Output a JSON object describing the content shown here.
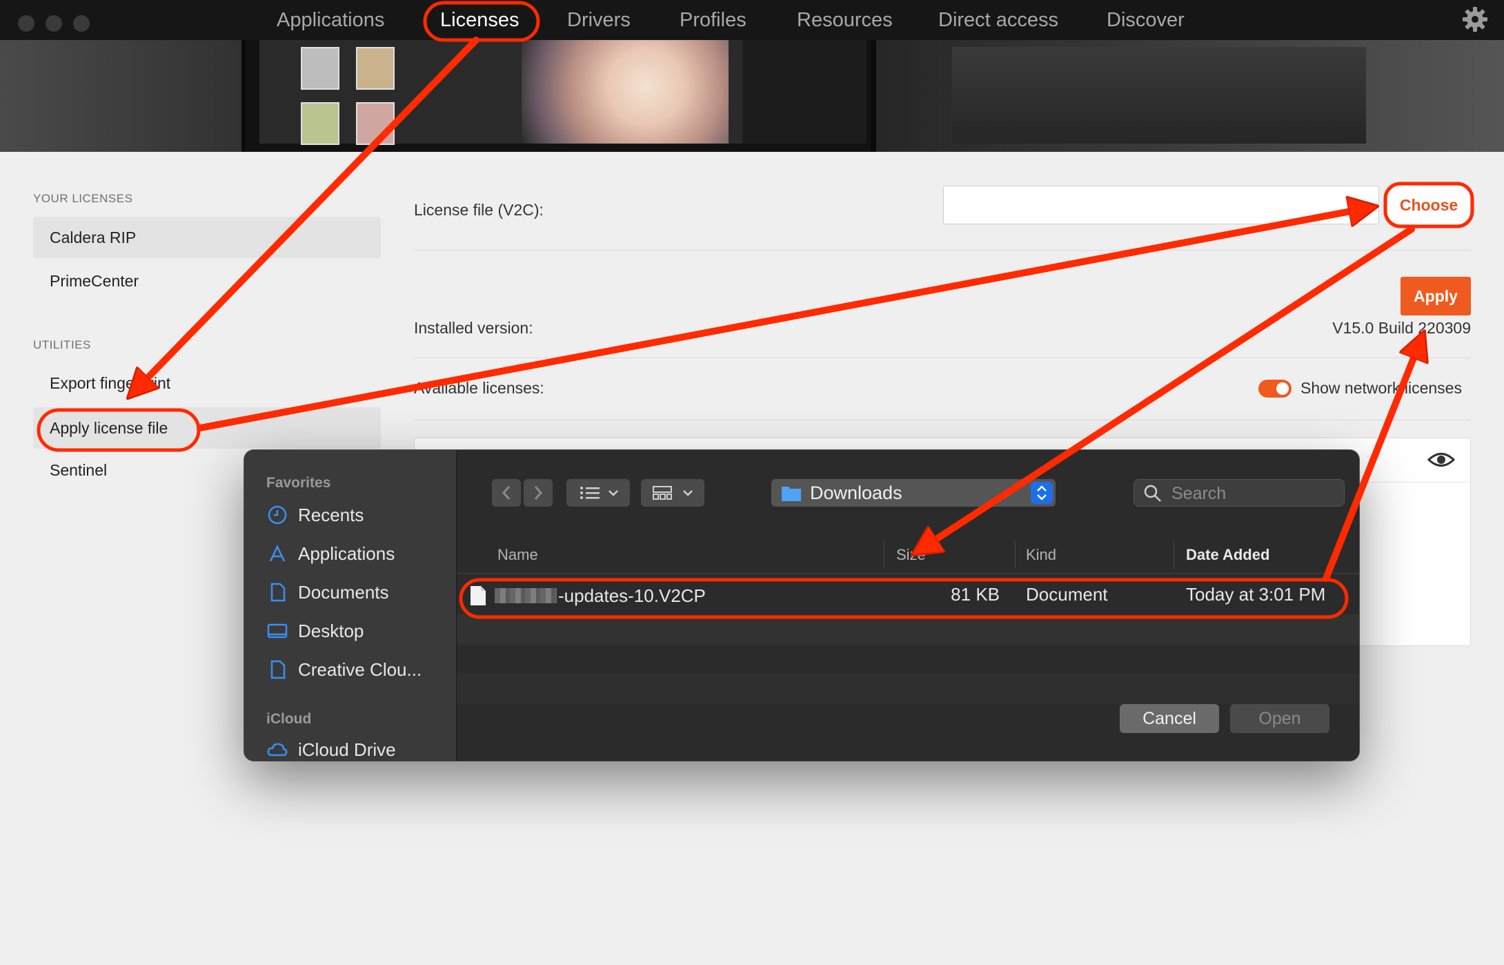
{
  "nav": {
    "tabs": [
      {
        "label": "Applications"
      },
      {
        "label": "Licenses"
      },
      {
        "label": "Drivers"
      },
      {
        "label": "Profiles"
      },
      {
        "label": "Resources"
      },
      {
        "label": "Direct access"
      },
      {
        "label": "Discover"
      }
    ],
    "active": "Licenses"
  },
  "sidebar": {
    "your_licenses_label": "YOUR LICENSES",
    "licenses": [
      {
        "label": "Caldera RIP"
      },
      {
        "label": "PrimeCenter"
      }
    ],
    "utilities_label": "UTILITIES",
    "utilities": [
      {
        "label": "Export fingerprint"
      },
      {
        "label": "Apply license file"
      },
      {
        "label": "Sentinel"
      }
    ]
  },
  "main": {
    "license_file_label": "License file (V2C):",
    "license_file_value": "",
    "choose_label": "Choose",
    "apply_label": "Apply",
    "installed_version_label": "Installed version:",
    "installed_version_value": "V15.0 Build 220309",
    "available_licenses_label": "Available licenses:",
    "show_network_label": "Show network licenses",
    "show_network_on": true
  },
  "dialog": {
    "favorites_label": "Favorites",
    "favorites": [
      {
        "label": "Recents",
        "icon": "clock-icon"
      },
      {
        "label": "Applications",
        "icon": "apps-icon"
      },
      {
        "label": "Documents",
        "icon": "document-icon"
      },
      {
        "label": "Desktop",
        "icon": "desktop-icon"
      },
      {
        "label": "Creative Clou...",
        "icon": "document-icon"
      }
    ],
    "icloud_label": "iCloud",
    "icloud": [
      {
        "label": "iCloud Drive",
        "icon": "cloud-icon"
      }
    ],
    "location": "Downloads",
    "search_placeholder": "Search",
    "columns": {
      "name": "Name",
      "size": "Size",
      "kind": "Kind",
      "date_added": "Date Added"
    },
    "files": [
      {
        "name": "-updates-10.V2CP",
        "size": "81 KB",
        "kind": "Document",
        "date_added": "Today at 3:01 PM"
      }
    ],
    "cancel_label": "Cancel",
    "open_label": "Open"
  },
  "colors": {
    "accent": "#ef5a1e",
    "annotation": "#ff2a00",
    "dialog_bg": "#2b2b2b",
    "topbar_bg": "#161616"
  }
}
